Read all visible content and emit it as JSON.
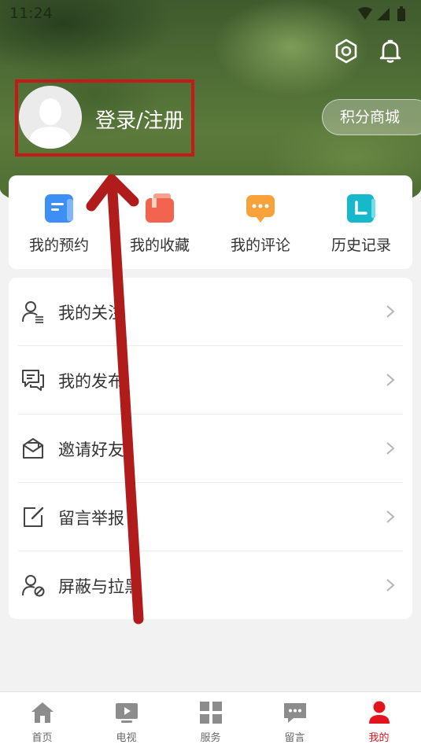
{
  "status_bar": {
    "time": "11:24"
  },
  "profile": {
    "login_label": "登录/注册"
  },
  "points_mall": {
    "label": "积分商城"
  },
  "quick_actions": [
    {
      "label": "我的预约",
      "icon": "calendar-icon",
      "color": "#3d8ff5"
    },
    {
      "label": "我的收藏",
      "icon": "bookmark-icon",
      "color": "#f2644f"
    },
    {
      "label": "我的评论",
      "icon": "comment-icon",
      "color": "#f7a23a"
    },
    {
      "label": "历史记录",
      "icon": "history-icon",
      "color": "#16b8c9"
    }
  ],
  "menu": [
    {
      "label": "我的关注",
      "icon": "follow-icon"
    },
    {
      "label": "我的发布",
      "icon": "publish-icon"
    },
    {
      "label": "邀请好友",
      "icon": "invite-icon"
    },
    {
      "label": "留言举报",
      "icon": "report-icon"
    },
    {
      "label": "屏蔽与拉黑",
      "icon": "block-icon"
    }
  ],
  "tabbar": [
    {
      "label": "首页",
      "icon": "home-icon",
      "active": false
    },
    {
      "label": "电视",
      "icon": "tv-icon",
      "active": false
    },
    {
      "label": "服务",
      "icon": "services-icon",
      "active": false
    },
    {
      "label": "留言",
      "icon": "message-icon",
      "active": false
    },
    {
      "label": "我的",
      "icon": "profile-icon",
      "active": true
    }
  ],
  "colors": {
    "accent": "#e3141b",
    "highlight_box": "#c8191a",
    "annotation_arrow": "#b01c1c"
  }
}
